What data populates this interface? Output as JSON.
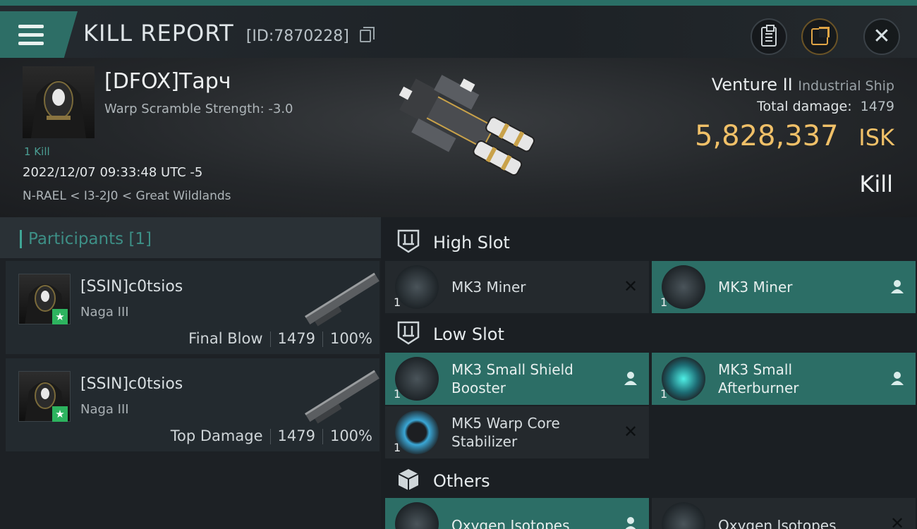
{
  "header": {
    "title": "KILL REPORT",
    "report_id": "[ID:7870228]",
    "icons": [
      "menu-icon",
      "copy-icon",
      "clipboard-icon",
      "share-icon",
      "close-icon"
    ]
  },
  "victim": {
    "name": "[DFOX]Тарч",
    "warp_scramble": "Warp Scramble Strength: -3.0",
    "kills": "1 Kill",
    "date": "2022/12/07 09:33:48 UTC -5",
    "location": "N-RAEL < I3-2J0 < Great Wildlands",
    "ship": "Venture II",
    "ship_class": "Industrial Ship",
    "total_damage_label": "Total damage:",
    "total_damage": "1479",
    "isk_value": "5,828,337",
    "isk_unit": "ISK",
    "result": "Kill"
  },
  "participants": {
    "title": "Participants",
    "count": "[1]",
    "items": [
      {
        "name": "[SSIN]c0tsios",
        "ship": "Naga III",
        "role": "Final Blow",
        "damage": "1479",
        "percent": "100%"
      },
      {
        "name": "[SSIN]c0tsios",
        "ship": "Naga III",
        "role": "Top Damage",
        "damage": "1479",
        "percent": "100%"
      }
    ]
  },
  "modules": {
    "high_slot": {
      "label": "High Slot",
      "items": [
        {
          "name": "MK3 Miner",
          "qty": "1",
          "state": "destroyed"
        },
        {
          "name": "MK3 Miner",
          "qty": "1",
          "state": "dropped"
        }
      ]
    },
    "low_slot": {
      "label": "Low Slot",
      "items": [
        {
          "name": "MK3 Small Shield Booster",
          "qty": "1",
          "state": "dropped"
        },
        {
          "name": "MK3 Small Afterburner",
          "qty": "1",
          "state": "dropped"
        },
        {
          "name": "MK5 Warp Core Stabilizer",
          "qty": "1",
          "state": "destroyed"
        }
      ]
    },
    "others": {
      "label": "Others",
      "items": [
        {
          "name": "Oxygen Isotopes",
          "state": "dropped"
        },
        {
          "name": "Oxygen Isotopes",
          "state": "destroyed"
        }
      ]
    }
  },
  "colors": {
    "accent": "#2c6e66",
    "isk": "#f0c068",
    "star_badge": "#2db35f"
  }
}
